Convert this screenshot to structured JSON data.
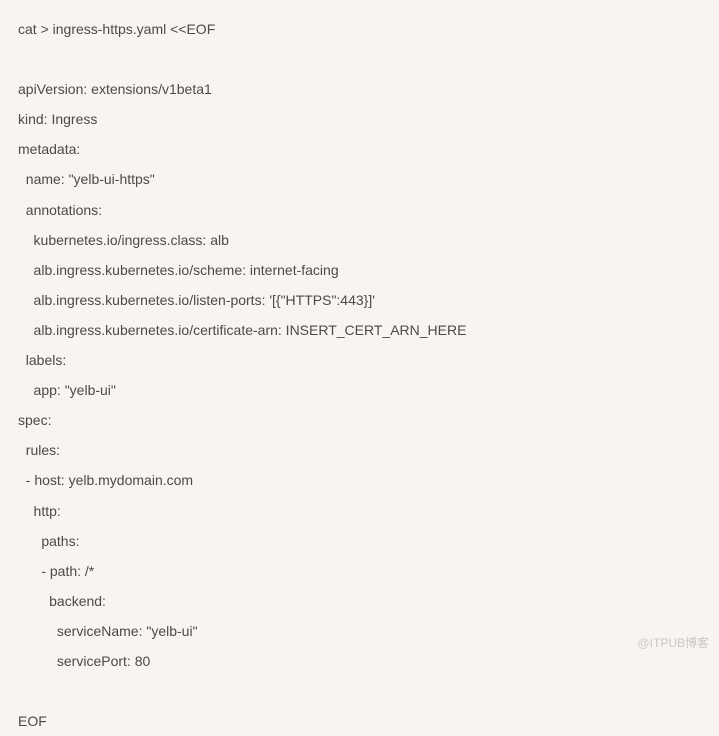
{
  "code": {
    "lines": [
      "cat > ingress-https.yaml <<EOF",
      "",
      "apiVersion: extensions/v1beta1",
      "kind: Ingress",
      "metadata:",
      "  name: \"yelb-ui-https\"",
      "  annotations:",
      "    kubernetes.io/ingress.class: alb",
      "    alb.ingress.kubernetes.io/scheme: internet-facing",
      "    alb.ingress.kubernetes.io/listen-ports: '[{\"HTTPS\":443}]'",
      "    alb.ingress.kubernetes.io/certificate-arn: INSERT_CERT_ARN_HERE",
      "  labels:",
      "    app: \"yelb-ui\"",
      "spec:",
      "  rules:",
      "  - host: yelb.mydomain.com",
      "    http:",
      "      paths:",
      "      - path: /*",
      "        backend:",
      "          serviceName: \"yelb-ui\"",
      "          servicePort: 80",
      "",
      "EOF"
    ]
  },
  "watermark": "@ITPUB博客"
}
